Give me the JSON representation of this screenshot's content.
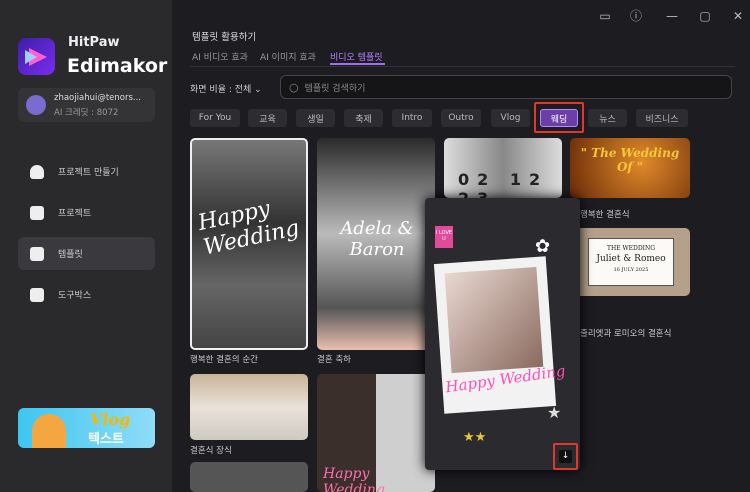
{
  "app": {
    "brand_top": "HitPaw",
    "brand_name": "Edimakor"
  },
  "user": {
    "email": "zhaojiahui@tenors...",
    "credits": "AI 크레딧 : 8072"
  },
  "sidebar": {
    "items": [
      {
        "label": "프로젝트 만들기"
      },
      {
        "label": "프로젝트"
      },
      {
        "label": "템플릿"
      },
      {
        "label": "도구박스"
      }
    ],
    "banner": {
      "title": "Vlog",
      "subtitle": "텍스트"
    }
  },
  "header": {
    "title": "템플릿 활용하기",
    "tabs": [
      {
        "label": "AI 비디오 효과"
      },
      {
        "label": "AI 이미지 효과"
      },
      {
        "label": "비디오 템플릿"
      }
    ]
  },
  "filters": {
    "ratio": "화면 비율 : 전체",
    "search_placeholder": "템플릿 검색하기",
    "chips": [
      "For You",
      "교육",
      "생일",
      "축제",
      "Intro",
      "Outro",
      "Vlog",
      "웨딩",
      "뉴스",
      "비즈니스"
    ],
    "selected": "웨딩"
  },
  "templates": [
    {
      "label": "행복한 결혼의 순간",
      "art": "Happy Wedding"
    },
    {
      "label": "결혼 축하",
      "art": "Adela & Baron"
    },
    {
      "art": "02 12 23"
    },
    {
      "label": "행복한 결혼식",
      "art": "\" The Wedding Of \""
    },
    {
      "label": "줄리엣과 로미오의 결혼식",
      "art1": "THE WEDDING",
      "art2": "Juliet & Romeo",
      "art3": "16 JULY 2025"
    },
    {
      "label": "결혼식 장식"
    },
    {
      "art": "Happy Wedding"
    }
  ],
  "preview": {
    "art": "Happy Wedding",
    "sticker": "I LOVE U"
  },
  "colors": {
    "accent": "#a46cf5",
    "highlight": "#e0392b"
  }
}
